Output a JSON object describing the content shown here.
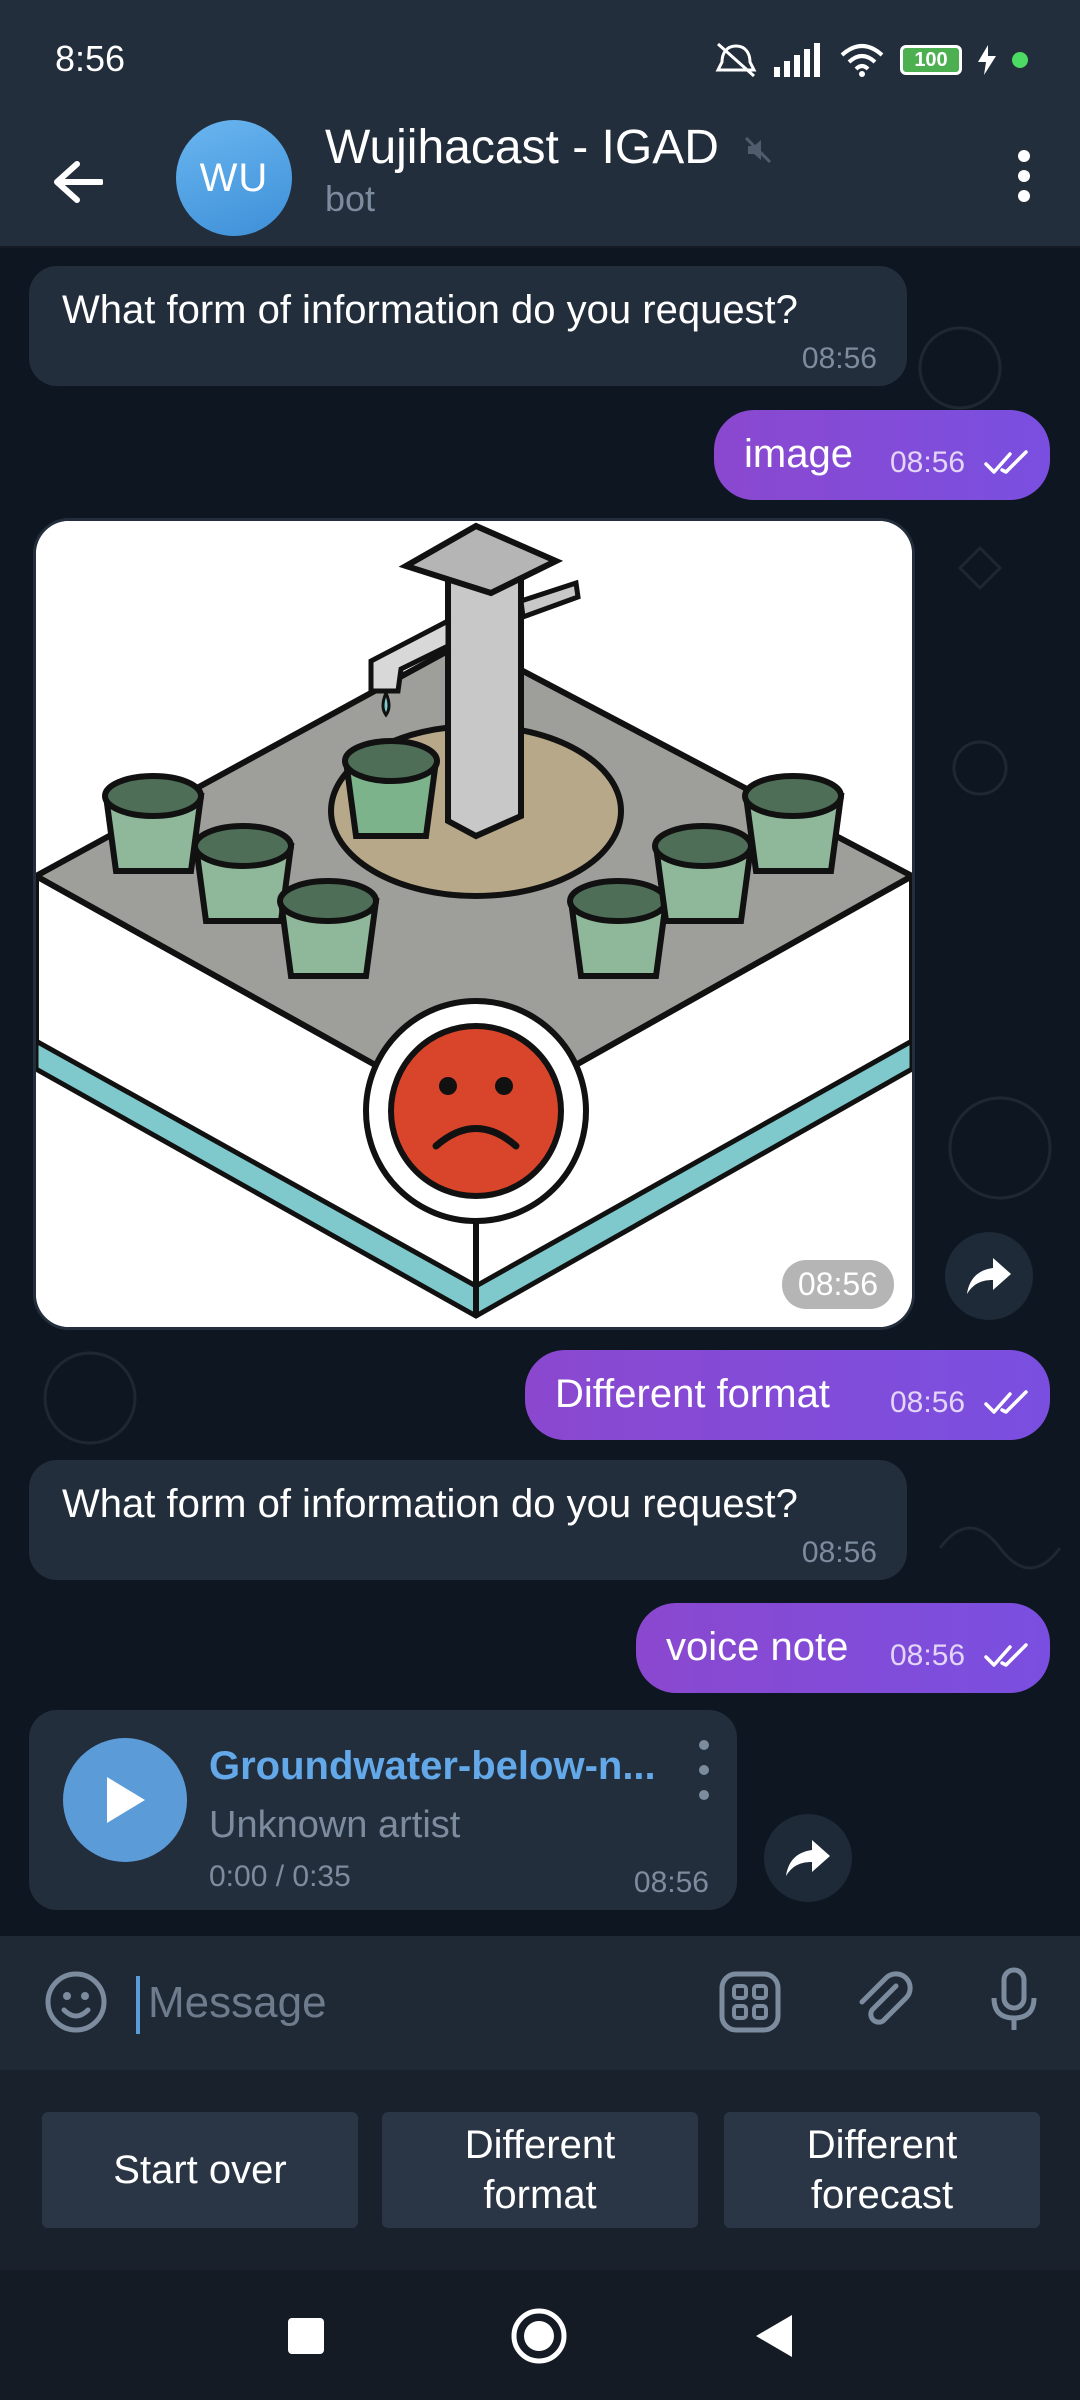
{
  "status_bar": {
    "time": "8:56",
    "battery": "100"
  },
  "header": {
    "avatar_initials": "WU",
    "title": "Wujihacast - IGAD",
    "subtitle": "bot"
  },
  "messages": [
    {
      "direction": "in",
      "text": "What form of information do you request?",
      "time": "08:56"
    },
    {
      "direction": "out",
      "text": "image",
      "time": "08:56"
    },
    {
      "direction": "in",
      "type": "image",
      "time": "08:56"
    },
    {
      "direction": "out",
      "text": "Different format",
      "time": "08:56"
    },
    {
      "direction": "in",
      "text": "What form of information do you request?",
      "time": "08:56"
    },
    {
      "direction": "out",
      "text": "voice note",
      "time": "08:56"
    },
    {
      "direction": "in",
      "type": "audio",
      "title": "Groundwater-below-n...",
      "artist": "Unknown artist",
      "duration": "0:00 / 0:35",
      "time": "08:56"
    }
  ],
  "composer": {
    "placeholder": "Message"
  },
  "keyboard": {
    "buttons": [
      "Start over",
      "Different\nformat",
      "Different\nforecast"
    ]
  },
  "colors": {
    "outgoing_bubble": "#8b48cf",
    "incoming_bubble": "#232e3c",
    "chat_background": "#0e1621",
    "accent_blue": "#5b9bd8"
  }
}
